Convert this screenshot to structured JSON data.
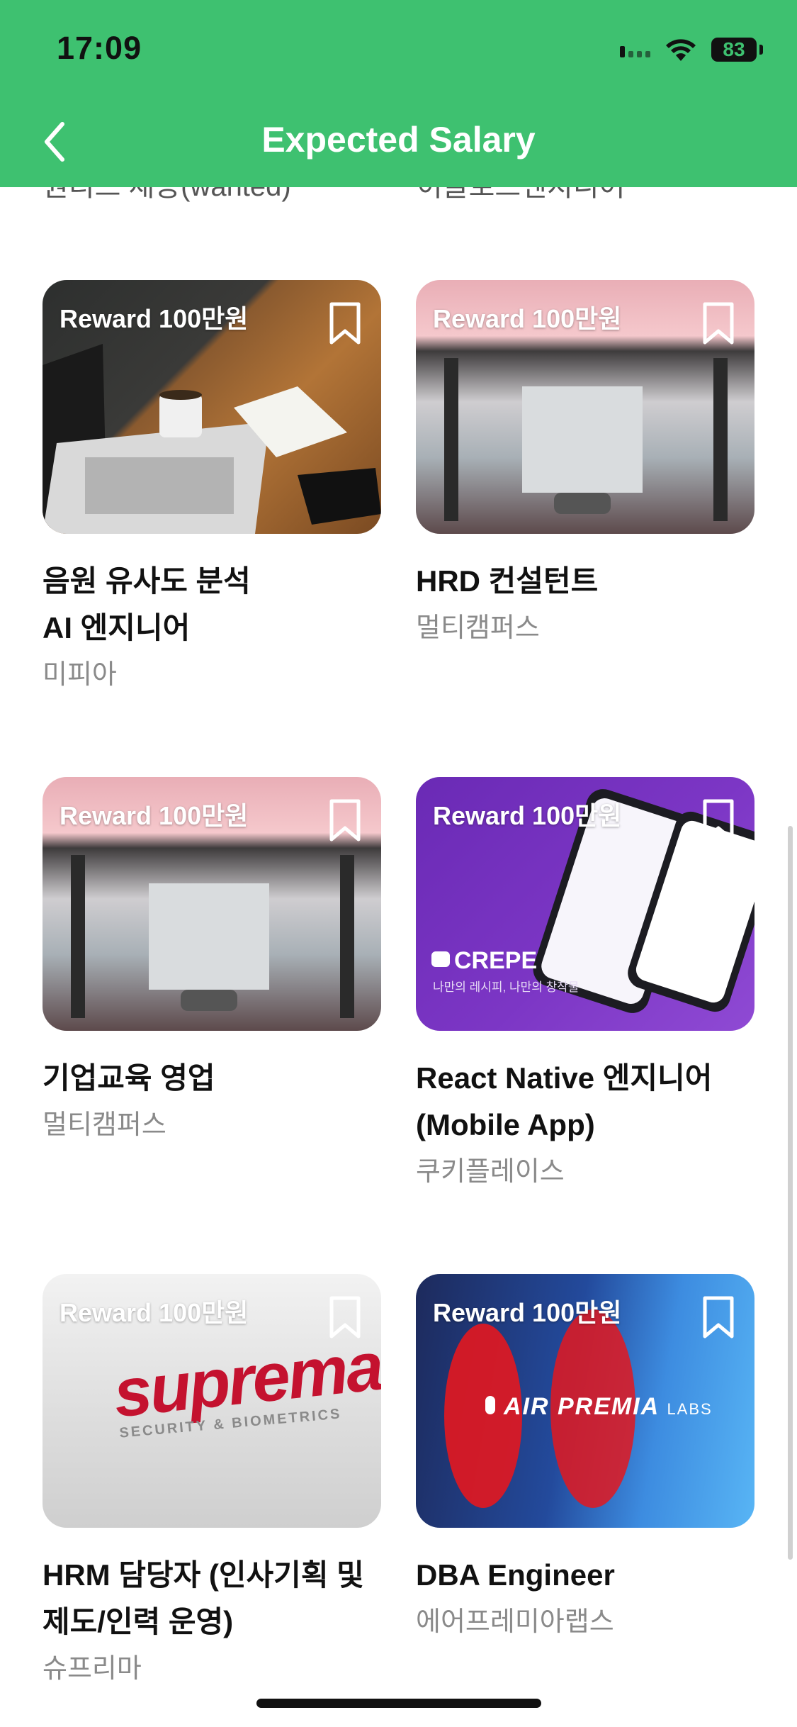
{
  "status_bar": {
    "time": "17:09",
    "battery": "83"
  },
  "header": {
    "title": "Expected Salary"
  },
  "peek_texts": [
    "원티드 채용(wanted)",
    "이글로드엔지니어"
  ],
  "jobs": [
    {
      "reward": "Reward 100만원",
      "title_line1": "음원 유사도 분석",
      "title_line2": "AI 엔지니어",
      "company": "미피아",
      "image": "laptop-desk-photo"
    },
    {
      "reward": "Reward 100만원",
      "title_line1": "HRD 컨설턴트",
      "title_line2": "",
      "company": "멀티캠퍼스",
      "image": "balloon-office-photo"
    },
    {
      "reward": "Reward 100만원",
      "title_line1": "기업교육 영업",
      "title_line2": "",
      "company": "멀티캠퍼스",
      "image": "balloon-office-photo"
    },
    {
      "reward": "Reward 100만원",
      "title_line1": "React Native 엔지니어",
      "title_line2": "(Mobile App)",
      "company": "쿠키플레이스",
      "image": "crepe-app-promo",
      "brand": "CREPE",
      "brand_tagline": "나만의 레시피, 나만의 창작물"
    },
    {
      "reward": "Reward 100만원",
      "title_line1": "HRM 담당자 (인사기획 및",
      "title_line2": "제도/인력 운영)",
      "company": "슈프리마",
      "image": "suprema-sign-photo",
      "brand": "suprema",
      "brand_tagline": "SECURITY & BIOMETRICS"
    },
    {
      "reward": "Reward 100만원",
      "title_line1": "DBA Engineer",
      "title_line2": "",
      "company": "에어프레미아랩스",
      "image": "air-premia-labs-photo",
      "brand": "AIR PREMIA",
      "brand_suffix": "LABS"
    }
  ],
  "colors": {
    "header_bg": "#3ec170",
    "title": "#ffffff",
    "company": "#8a8a8a"
  }
}
